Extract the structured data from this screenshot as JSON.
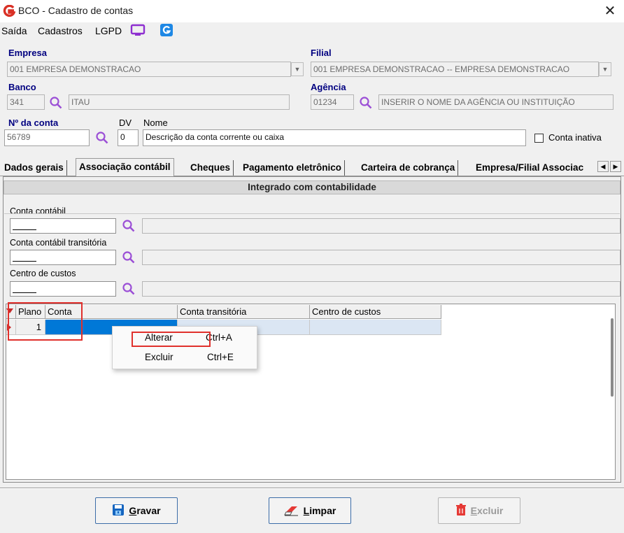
{
  "window": {
    "title": "BCO - Cadastro de contas",
    "close_label": "✕"
  },
  "menu": {
    "items": [
      "Saída",
      "Cadastros",
      "LGPD"
    ]
  },
  "empresa": {
    "label": "Empresa",
    "value": "001 EMPRESA DEMONSTRACAO"
  },
  "filial": {
    "label": "Filial",
    "value": "001 EMPRESA DEMONSTRACAO -- EMPRESA DEMONSTRACAO"
  },
  "banco": {
    "label": "Banco",
    "code": "341",
    "name": "ITAU"
  },
  "agencia": {
    "label": "Agência",
    "code": "01234",
    "name": "INSERIR O NOME DA AGÊNCIA OU INSTITUIÇÃO"
  },
  "conta": {
    "label": "Nº da conta",
    "value": "56789",
    "dv_label": "DV",
    "dv_value": "0",
    "nome_label": "Nome",
    "nome_value": "Descrição da conta corrente ou caixa",
    "inativa_label": "Conta inativa",
    "inativa_checked": false
  },
  "tabs": [
    "Dados gerais",
    "Associação contábil",
    "Cheques",
    "Pagamento eletrônico",
    "Carteira de cobrança",
    "Empresa/Filial Associac"
  ],
  "active_tab": "Associação contábil",
  "group": {
    "title": "Integrado com contabilidade"
  },
  "fields": {
    "conta_contabil": "Conta contábil",
    "conta_transitoria": "Conta contábil transitória",
    "centro_custos": "Centro de custos"
  },
  "grid": {
    "columns": [
      "Plano",
      "Conta",
      "Conta transitória",
      "Centro de custos"
    ],
    "rows": [
      {
        "plano": "1",
        "conta": "",
        "conta_transitoria": "",
        "centro_custos": ""
      }
    ]
  },
  "context_menu": {
    "items": [
      {
        "label": "Alterar",
        "shortcut": "Ctrl+A"
      },
      {
        "label": "Excluir",
        "shortcut": "Ctrl+E"
      }
    ]
  },
  "buttons": {
    "gravar": {
      "first": "G",
      "rest": "ravar",
      "enabled": true
    },
    "limpar": {
      "first": "L",
      "rest": "impar",
      "enabled": true
    },
    "excluir": {
      "first": "E",
      "rest": "xcluir",
      "enabled": false
    }
  },
  "colors": {
    "label_blue": "#000080",
    "accent_purple": "#9b4fd6",
    "highlight_red": "#e0302c",
    "selection_blue": "#0078d7"
  }
}
